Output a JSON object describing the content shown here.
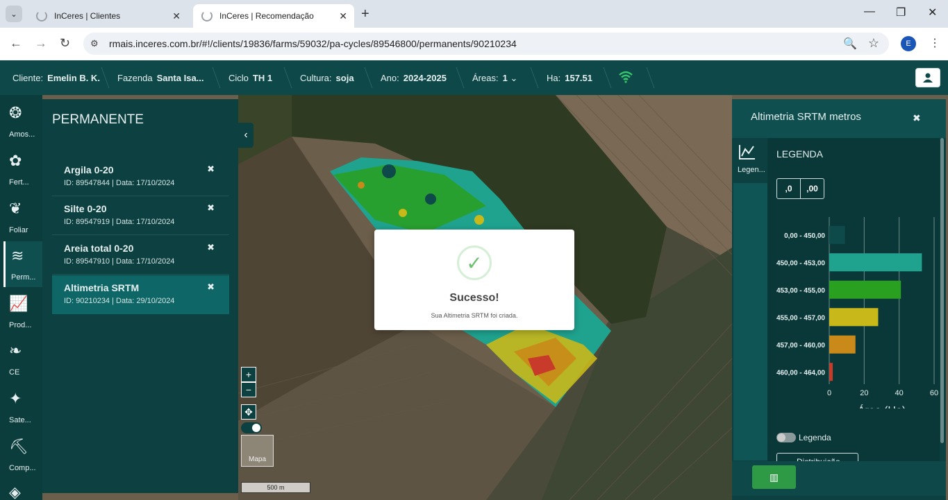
{
  "browser": {
    "tabs": [
      {
        "title": "InCeres | Clientes",
        "active": false
      },
      {
        "title": "InCeres | Recomendação",
        "active": true
      }
    ],
    "url": "rmais.inceres.com.br/#!/clients/19836/farms/59032/pa-cycles/89546800/permanents/90210234",
    "profile_initial": "E"
  },
  "header": {
    "client_label": "Cliente:",
    "client_value": "Emelin B. K.",
    "farm_label": "Fazenda",
    "farm_value": "Santa Isa...",
    "cycle_label": "Ciclo",
    "cycle_value": "TH 1",
    "crop_label": "Cultura:",
    "crop_value": "soja",
    "year_label": "Ano:",
    "year_value": "2024-2025",
    "areas_label": "Áreas:",
    "areas_value": "1",
    "ha_label": "Ha:",
    "ha_value": "157.51"
  },
  "leftnav": [
    {
      "label": "Amos...",
      "icon": "samples-icon"
    },
    {
      "label": "Fert...",
      "icon": "fertility-icon"
    },
    {
      "label": "Foliar",
      "icon": "leaf-icon"
    },
    {
      "label": "Perm...",
      "icon": "permanent-icon",
      "active": true
    },
    {
      "label": "Prod...",
      "icon": "productivity-chart-icon"
    },
    {
      "label": "CE",
      "icon": "plant-icon"
    },
    {
      "label": "Sate...",
      "icon": "satellite-icon"
    },
    {
      "label": "Comp...",
      "icon": "compaction-icon"
    }
  ],
  "permanent_panel": {
    "title": "PERMANENTE",
    "items": [
      {
        "name": "Argila 0-20",
        "meta": "ID: 89547844 | Data: 17/10/2024"
      },
      {
        "name": "Silte 0-20",
        "meta": "ID: 89547919 | Data: 17/10/2024"
      },
      {
        "name": "Areia total 0-20",
        "meta": "ID: 89547910 | Data: 17/10/2024"
      },
      {
        "name": "Altimetria SRTM",
        "meta": "ID: 90210234 | Data: 29/10/2024",
        "selected": true
      }
    ]
  },
  "map": {
    "zoom_in": "+",
    "zoom_out": "−",
    "basemap_label": "Mapa",
    "scale_label": "500 m"
  },
  "modal": {
    "title": "Sucesso!",
    "message": "Sua Altimetria SRTM foi criada."
  },
  "right_panel": {
    "title": "Altimetria SRTM metros",
    "side_tab_label": "Legen...",
    "legend_title": "LEGENDA",
    "decimal_btn_minus": ",0",
    "decimal_btn_plus": ",00",
    "legend_toggle_label": "Legenda",
    "distribution_btn": "Distribuição"
  },
  "chart_data": {
    "type": "bar",
    "orientation": "horizontal",
    "categories": [
      "0,00 - 450,00",
      "450,00 - 453,00",
      "453,00 - 455,00",
      "455,00 - 457,00",
      "457,00 - 460,00",
      "460,00 - 464,00"
    ],
    "values": [
      0,
      53,
      41,
      28,
      15,
      2
    ],
    "colors": [
      "#0f4a4a",
      "#1fa38f",
      "#2aa020",
      "#c9b81a",
      "#c98a1a",
      "#c83a2a"
    ],
    "xlabel": "Área (Ha)",
    "xlim": [
      0,
      60
    ],
    "xticks": [
      0,
      20,
      40,
      60
    ],
    "grid": true
  }
}
